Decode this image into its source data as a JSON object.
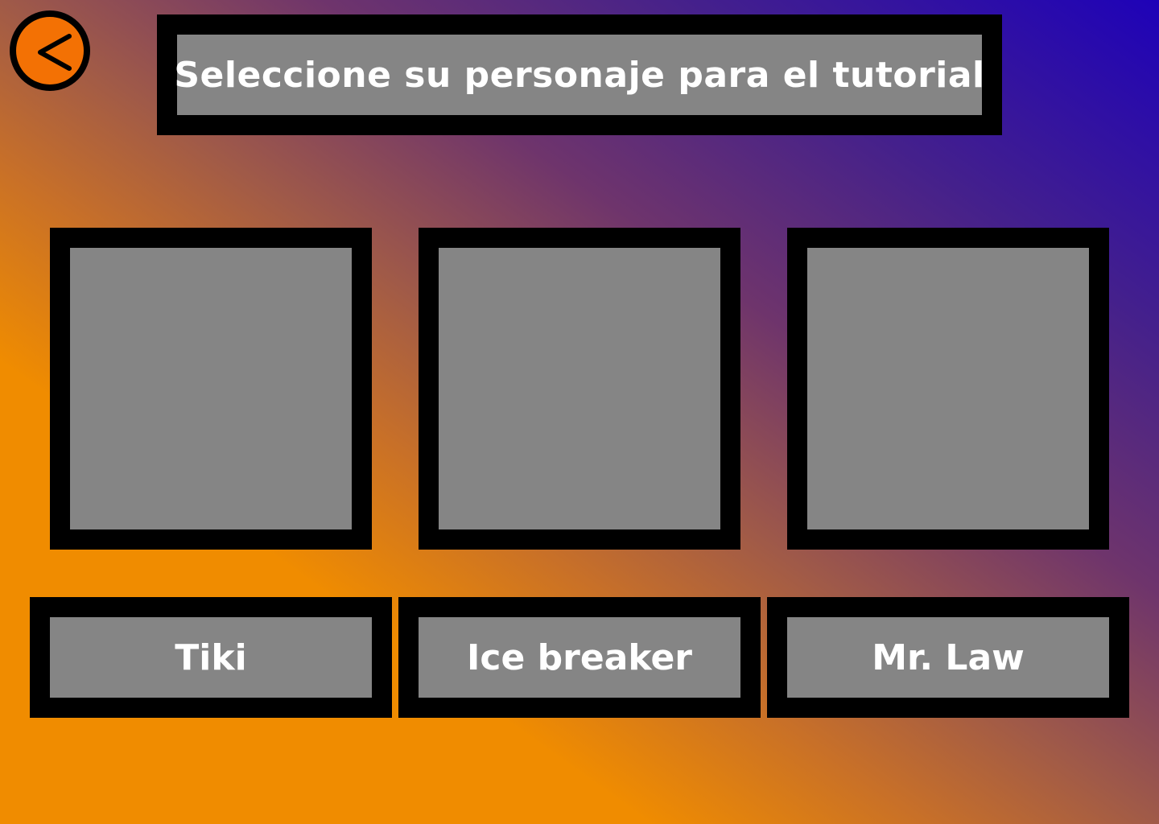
{
  "title": "Seleccione su personaje para el tutorial",
  "back_button": {
    "icon": "chevron-left-icon"
  },
  "characters": [
    {
      "name": "Tiki"
    },
    {
      "name": "Ice breaker"
    },
    {
      "name": "Mr. Law"
    }
  ],
  "colors": {
    "background_gradient_start": "#f08c00",
    "background_gradient_end": "#1e02b8",
    "back_button": "#f37104",
    "frame": "#000000",
    "panel": "#8c8c8c",
    "text": "#ffffff"
  }
}
